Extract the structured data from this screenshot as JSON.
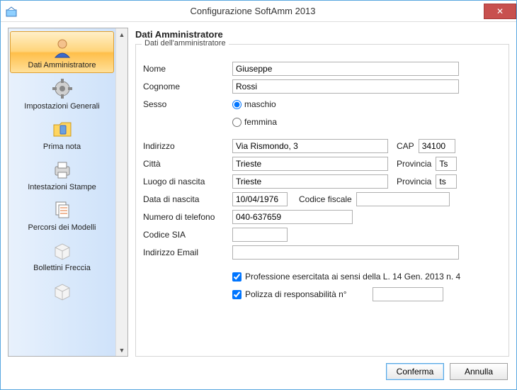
{
  "window": {
    "title": "Configurazione SoftAmm 2013"
  },
  "sidebar": {
    "items": [
      {
        "label": "Dati Amministratore",
        "icon": "user",
        "selected": true
      },
      {
        "label": "Impostazioni Generali",
        "icon": "gear",
        "selected": false
      },
      {
        "label": "Prima nota",
        "icon": "folder-phone",
        "selected": false
      },
      {
        "label": "Intestazioni Stampe",
        "icon": "printer",
        "selected": false
      },
      {
        "label": "Percorsi dei Modelli",
        "icon": "documents",
        "selected": false
      },
      {
        "label": "Bollettini Freccia",
        "icon": "box",
        "selected": false
      },
      {
        "label": "",
        "icon": "box",
        "selected": false
      }
    ]
  },
  "main": {
    "heading": "Dati Amministratore",
    "group_legend": "Dati dell'amministratore",
    "labels": {
      "nome": "Nome",
      "cognome": "Cognome",
      "sesso": "Sesso",
      "maschio": "maschio",
      "femmina": "femmina",
      "indirizzo": "Indirizzo",
      "cap": "CAP",
      "citta": "Città",
      "provincia": "Provincia",
      "luogo_nascita": "Luogo di nascita",
      "data_nascita": "Data di nascita",
      "codice_fiscale": "Codice fiscale",
      "numero_telefono": "Numero di telefono",
      "codice_sia": "Codice SIA",
      "indirizzo_email": "Indirizzo Email",
      "professione_chk": "Professione esercitata ai sensi della L. 14 Gen. 2013 n. 4",
      "polizza_chk": "Polizza di responsabilità n°"
    },
    "values": {
      "nome": "Giuseppe",
      "cognome": "Rossi",
      "sesso": "maschio",
      "indirizzo": "Via Rismondo, 3",
      "cap": "34100",
      "citta": "Trieste",
      "provincia_citta": "Ts",
      "luogo_nascita": "Trieste",
      "provincia_nascita": "ts",
      "data_nascita": "10/04/1976",
      "codice_fiscale": "",
      "numero_telefono": "040-637659",
      "codice_sia": "",
      "indirizzo_email": "",
      "professione_checked": true,
      "polizza_checked": true,
      "polizza_numero": ""
    }
  },
  "footer": {
    "confirm": "Conferma",
    "cancel": "Annulla"
  }
}
